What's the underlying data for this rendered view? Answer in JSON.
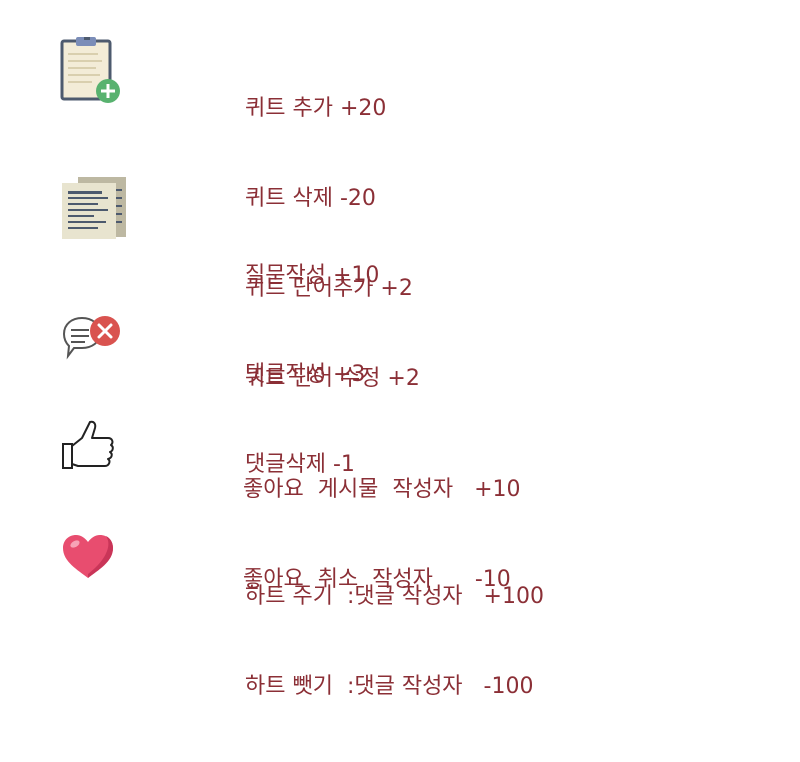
{
  "sections": [
    {
      "icon": "clipboard-add-icon",
      "lines": [
        "퀴트 추가 +20",
        "퀴트 삭제 -20",
        "퀴트 단어추가 +2",
        "퀴트 단어 수정 +2"
      ]
    },
    {
      "icon": "documents-icon",
      "lines": [
        "질문작성 +10"
      ]
    },
    {
      "icon": "comment-delete-icon",
      "lines": [
        "댓글작성 +3",
        "댓글삭제 -1"
      ]
    },
    {
      "icon": "thumbs-up-icon",
      "lines": [
        "좋아요  게시물  작성자   +10",
        "좋아요  취소  작성자      -10"
      ]
    },
    {
      "icon": "heart-icon",
      "lines": [
        "하트 주기  :댓글 작성자   +100",
        "하트 뺏기  :댓글 작성자   -100"
      ]
    }
  ],
  "colors": {
    "text": "#8b2f36",
    "clipboard_border": "#4d5a6e",
    "clipboard_paper": "#f3ecd7",
    "plus_badge": "#58b26f",
    "doc_paper": "#e8e4cf",
    "doc_lines": "#4d5a6e",
    "delete_badge": "#d9534f",
    "heart": "#e84d6f"
  }
}
